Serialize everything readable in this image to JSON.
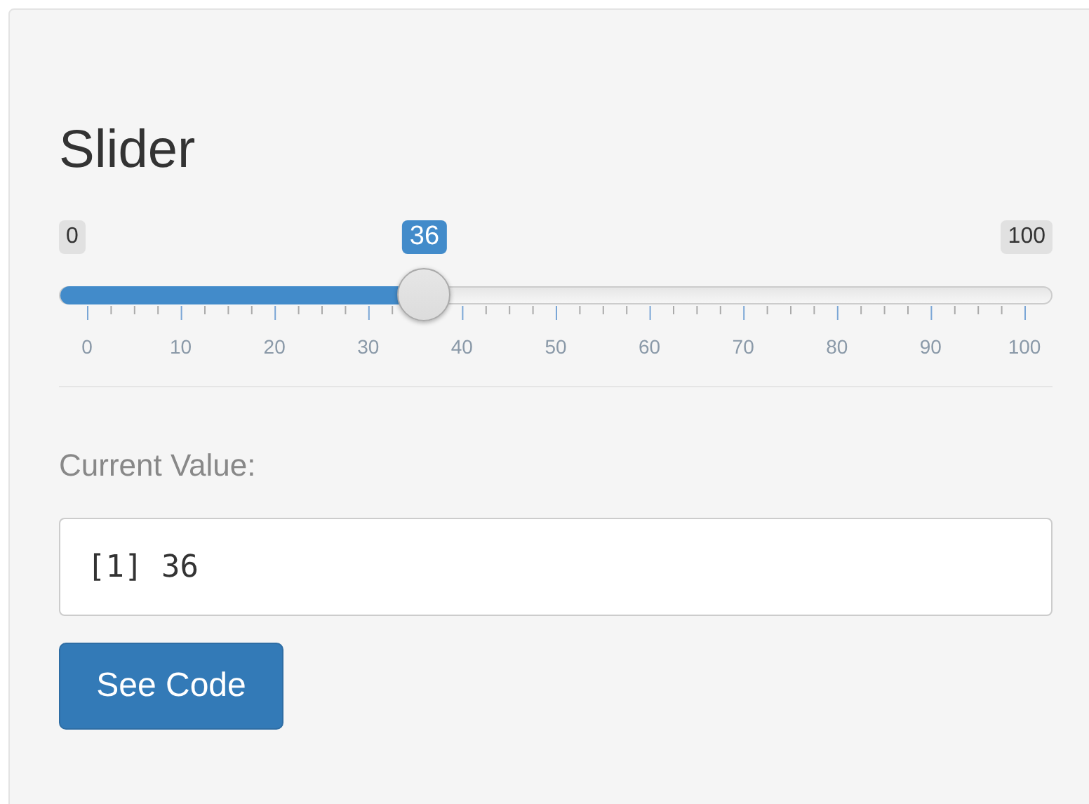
{
  "title": "Slider",
  "slider": {
    "min_label": "0",
    "max_label": "100",
    "value_label": "36",
    "level": 0.36,
    "tick_labels": [
      "0",
      "10",
      "20",
      "30",
      "40",
      "50",
      "60",
      "70",
      "80",
      "90",
      "100"
    ]
  },
  "output": {
    "label": "Current Value:",
    "value": "[1] 36"
  },
  "button": {
    "label": "See Code"
  }
}
